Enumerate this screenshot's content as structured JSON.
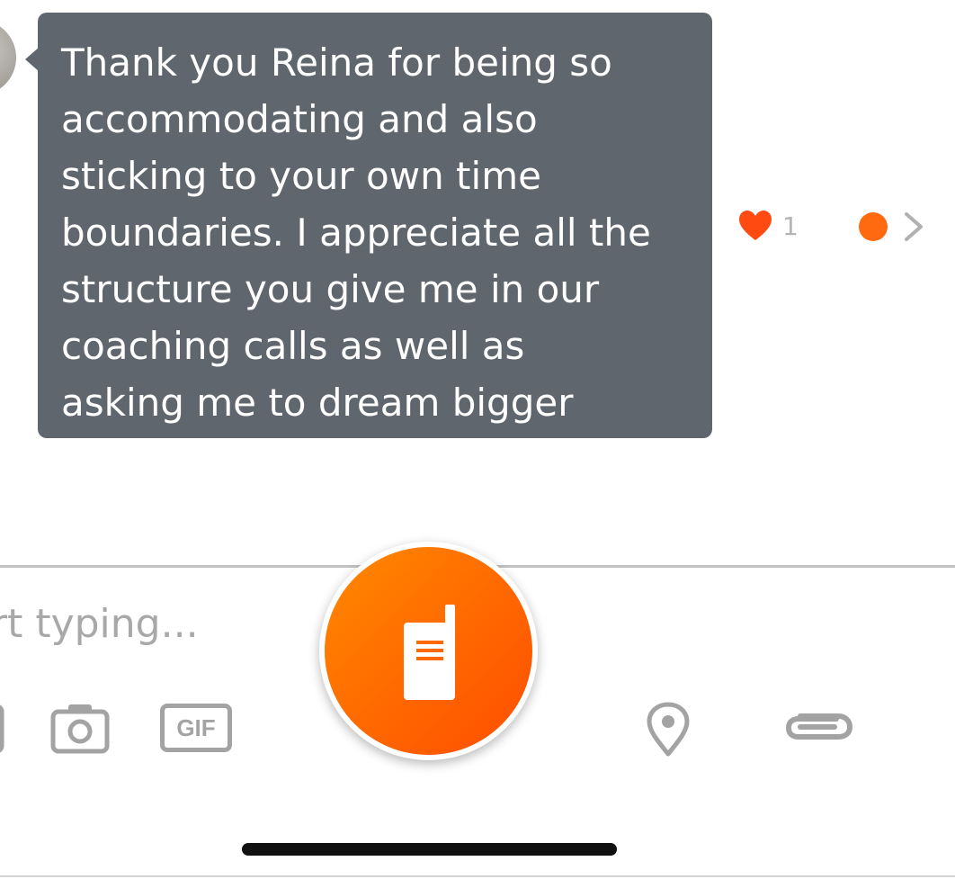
{
  "message": {
    "text": "Thank you Reina for being so\naccommodating and also\nsticking to your own time\nboundaries. I appreciate all the\nstructure you give me in our\ncoaching calls as well as\nasking me to dream bigger",
    "reaction_icon": "heart-icon",
    "reaction_count": "1",
    "status_icon": "unread-dot"
  },
  "composer": {
    "placeholder": "rt typing...",
    "icons": [
      "camera-icon",
      "gif-icon",
      "walkie-talkie-icon",
      "location-pin-icon",
      "paperclip-icon"
    ],
    "gif_label": "GIF"
  },
  "colors": {
    "accent": "#ff6a10",
    "bubble": "#5f666d",
    "icon_gray": "#a3a3a3"
  }
}
